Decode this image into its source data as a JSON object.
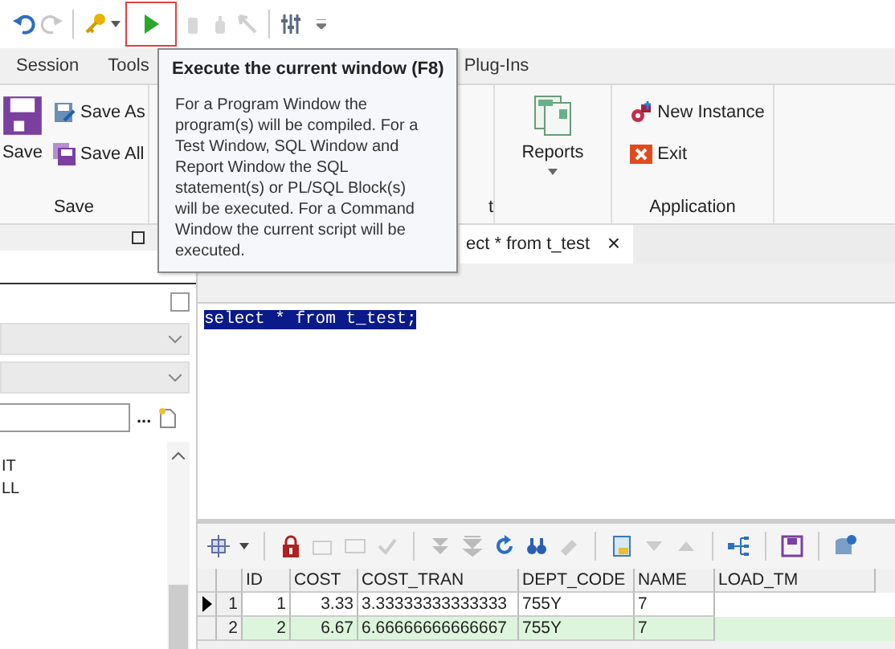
{
  "ribbon_tabs": [
    {
      "label": "Session",
      "selected": false
    },
    {
      "label": "Tools",
      "selected": false
    },
    {
      "label": "Plug-Ins",
      "selected": false
    }
  ],
  "ribbon": {
    "save_group": {
      "save": "Save",
      "save_as": "Save As",
      "save_all": "Save All",
      "label": "Save"
    },
    "cut_group_label": "t",
    "reports": "Reports",
    "application_group": {
      "new_instance": "New Instance",
      "exit": "Exit",
      "label": "Application"
    }
  },
  "tooltip": {
    "title": "Execute the current window (F8)",
    "body": "For a Program Window the program(s) will be compiled. For a Test Window, SQL Window and Report Window the SQL statement(s) or PL/SQL Block(s) will be executed. For a Command Window the current script will be executed."
  },
  "left_panel": {
    "checkbox_checked": false,
    "browse_button": "...",
    "items": [
      "IT",
      "LL"
    ]
  },
  "document_tab": {
    "label": "ect * from t_test",
    "close": "×"
  },
  "editor": {
    "sql": "select * from t_test;"
  },
  "grid": {
    "columns": [
      "ID",
      "COST",
      "COST_TRAN",
      "DEPT_CODE",
      "NAME",
      "LOAD_TM"
    ],
    "rows": [
      {
        "number": "1",
        "current": true,
        "cells": [
          "1",
          "3.33",
          "3.33333333333333",
          "755Y",
          "7"
        ]
      },
      {
        "number": "2",
        "current": false,
        "cells": [
          "2",
          "6.67",
          "6.66666666666667",
          "755Y",
          "7"
        ]
      }
    ]
  }
}
